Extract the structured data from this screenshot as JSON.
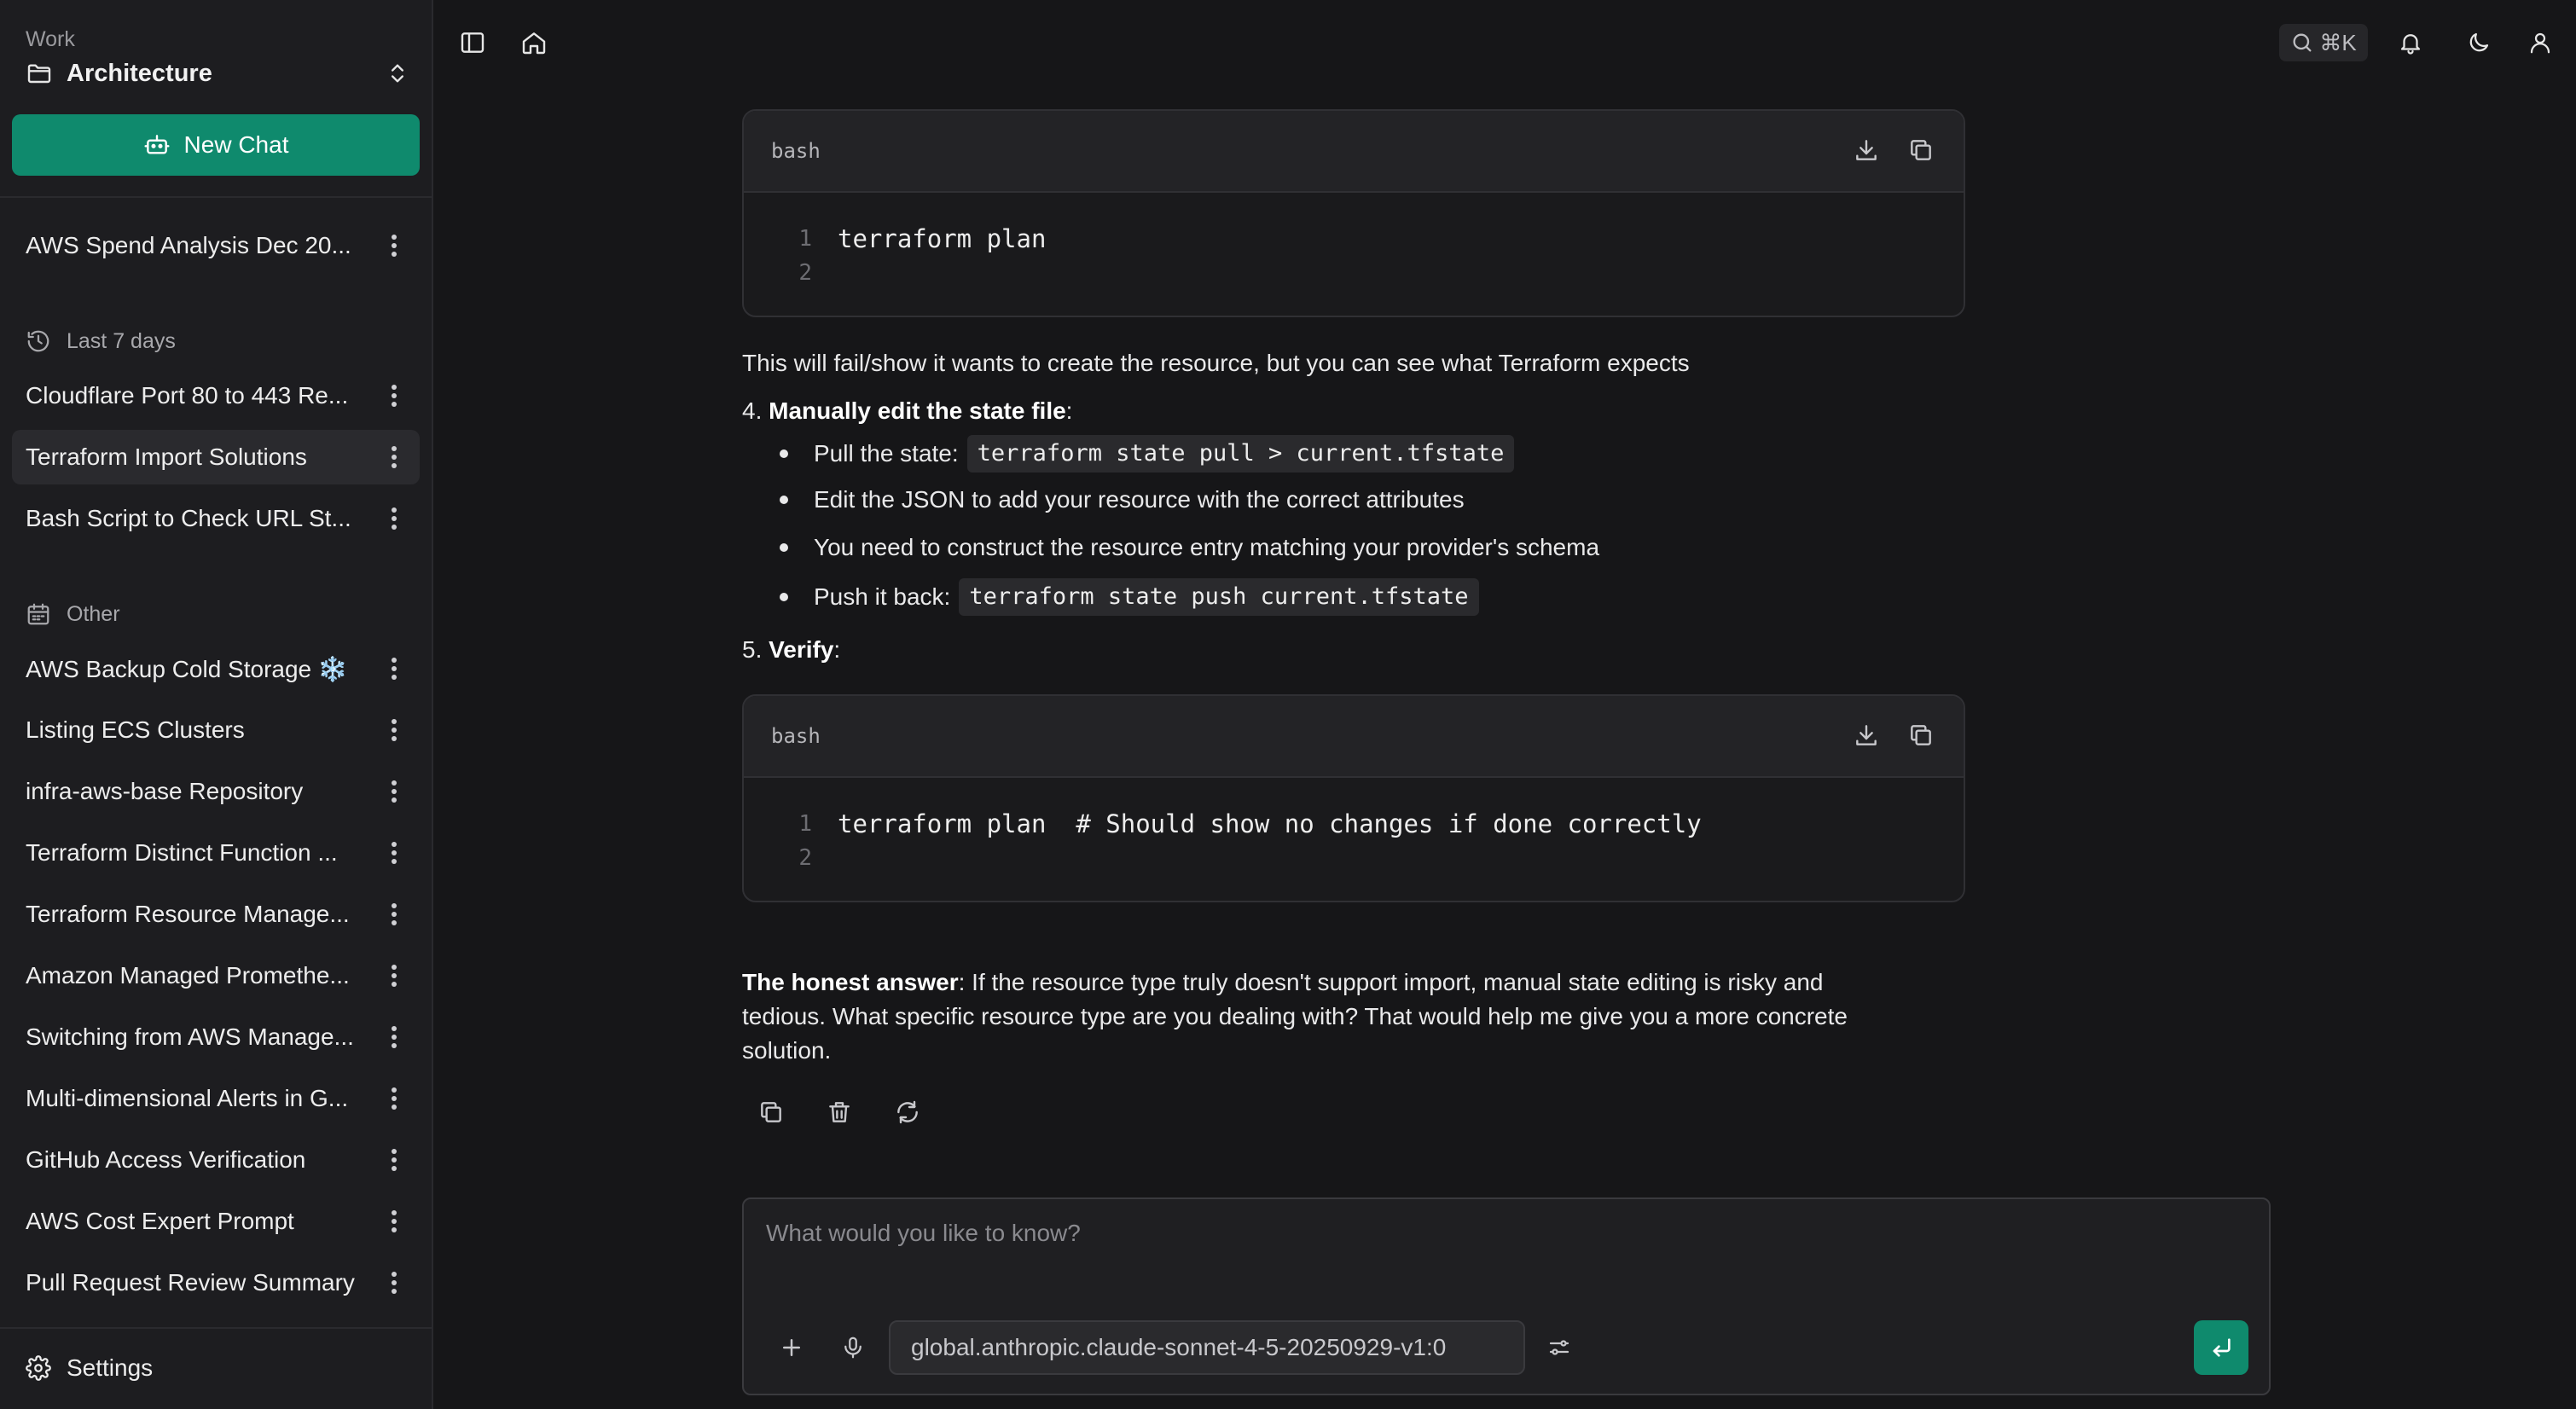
{
  "sidebar": {
    "workspace_label": "Work",
    "workspace_name": "Architecture",
    "new_chat_label": "New Chat",
    "pinned_items": [
      {
        "title": "AWS Spend Analysis Dec 20..."
      }
    ],
    "sections": [
      {
        "heading": "Last 7 days",
        "icon": "history-icon",
        "items": [
          {
            "title": "Cloudflare Port 80 to 443 Re..."
          },
          {
            "title": "Terraform Import Solutions",
            "active": true
          },
          {
            "title": "Bash Script to Check URL St..."
          }
        ]
      },
      {
        "heading": "Other",
        "icon": "calendar-icon",
        "items": [
          {
            "title": "AWS Backup Cold Storage ❄️"
          },
          {
            "title": "Listing ECS Clusters"
          },
          {
            "title": "infra-aws-base Repository"
          },
          {
            "title": "Terraform Distinct Function ..."
          },
          {
            "title": "Terraform Resource Manage..."
          },
          {
            "title": "Amazon Managed Promethe..."
          },
          {
            "title": "Switching from AWS Manage..."
          },
          {
            "title": "Multi-dimensional Alerts in G..."
          },
          {
            "title": "GitHub Access Verification"
          },
          {
            "title": "AWS Cost Expert Prompt"
          },
          {
            "title": "Pull Request Review Summary"
          }
        ]
      }
    ],
    "settings_label": "Settings"
  },
  "topbar": {
    "search_shortcut": "⌘K"
  },
  "content": {
    "code_block_1": {
      "lang": "bash",
      "lines": [
        "terraform plan",
        ""
      ],
      "line_numbers": [
        "1",
        "2"
      ]
    },
    "para_1": "This will fail/show it wants to create the resource, but you can see what Terraform expects",
    "step_4": {
      "number": "4.",
      "title": "Manually edit the state file",
      "suffix": ":"
    },
    "bullets": [
      {
        "text": "Pull the state:",
        "code": "terraform state pull > current.tfstate"
      },
      {
        "text": "Edit the JSON to add your resource with the correct attributes",
        "code": ""
      },
      {
        "text": "You need to construct the resource entry matching your provider's schema",
        "code": ""
      },
      {
        "text": "Push it back:",
        "code": "terraform state push current.tfstate"
      }
    ],
    "step_5": {
      "number": "5.",
      "title": "Verify",
      "suffix": ":"
    },
    "code_block_2": {
      "lang": "bash",
      "lines": [
        "terraform plan  # Should show no changes if done correctly",
        ""
      ],
      "line_numbers": [
        "1",
        "2"
      ]
    },
    "honest_label": "The honest answer",
    "honest_line_1": ": If the resource type truly doesn't support import, manual state editing is risky and",
    "honest_line_2": "tedious. What specific resource type are you dealing with? That would help me give you a more concrete",
    "honest_line_3": "solution."
  },
  "composer": {
    "placeholder": "What would you like to know?",
    "model": "global.anthropic.claude-sonnet-4-5-20250929-v1:0"
  },
  "colors": {
    "accent": "#0f8a6d",
    "background": "#161618",
    "sidebar": "#1d1d20"
  }
}
